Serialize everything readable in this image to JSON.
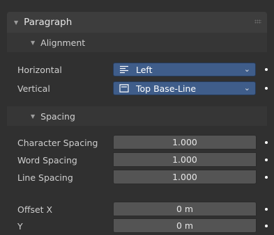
{
  "paragraph": {
    "title": "Paragraph",
    "alignment": {
      "title": "Alignment",
      "horizontal": {
        "label": "Horizontal",
        "value": "Left",
        "icon": "align-left-icon"
      },
      "vertical": {
        "label": "Vertical",
        "value": "Top Base-Line",
        "icon": "top-baseline-icon"
      }
    },
    "spacing": {
      "title": "Spacing",
      "character": {
        "label": "Character Spacing",
        "value": "1.000"
      },
      "word": {
        "label": "Word Spacing",
        "value": "1.000"
      },
      "line": {
        "label": "Line Spacing",
        "value": "1.000"
      }
    },
    "offset": {
      "x": {
        "label": "Offset X",
        "value": "0 m"
      },
      "y": {
        "label": "Y",
        "value": "0 m"
      }
    }
  },
  "colors": {
    "panel_bg": "#303030",
    "header_bg": "#3d3d3d",
    "dropdown_bg": "#3f5d8a",
    "field_bg": "#545454"
  }
}
